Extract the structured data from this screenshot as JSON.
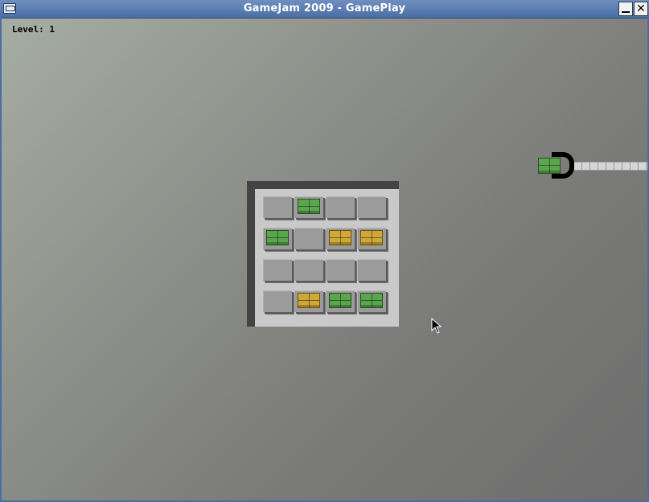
{
  "window": {
    "title": "GameJam 2009 - GamePlay",
    "minimize_symbol": "_",
    "close_symbol": "✕"
  },
  "hud": {
    "level_label": "Level:",
    "level_value": "1"
  },
  "board": {
    "rows": 4,
    "cols": 4,
    "cells": [
      [
        "empty",
        "green",
        "empty",
        "empty"
      ],
      [
        "green",
        "empty",
        "yellow",
        "yellow"
      ],
      [
        "empty",
        "empty",
        "empty",
        "empty"
      ],
      [
        "empty",
        "yellow",
        "green",
        "green"
      ]
    ]
  },
  "crane": {
    "held_block": "green"
  },
  "colors": {
    "green": "#5aa64e",
    "yellow": "#cfa838",
    "tile": "#9b9b9b",
    "wall": "#444444"
  },
  "icons": {
    "window_icon": "window-icon",
    "minimize": "minimize-icon",
    "close": "close-icon",
    "cursor": "mouse-pointer-icon"
  }
}
